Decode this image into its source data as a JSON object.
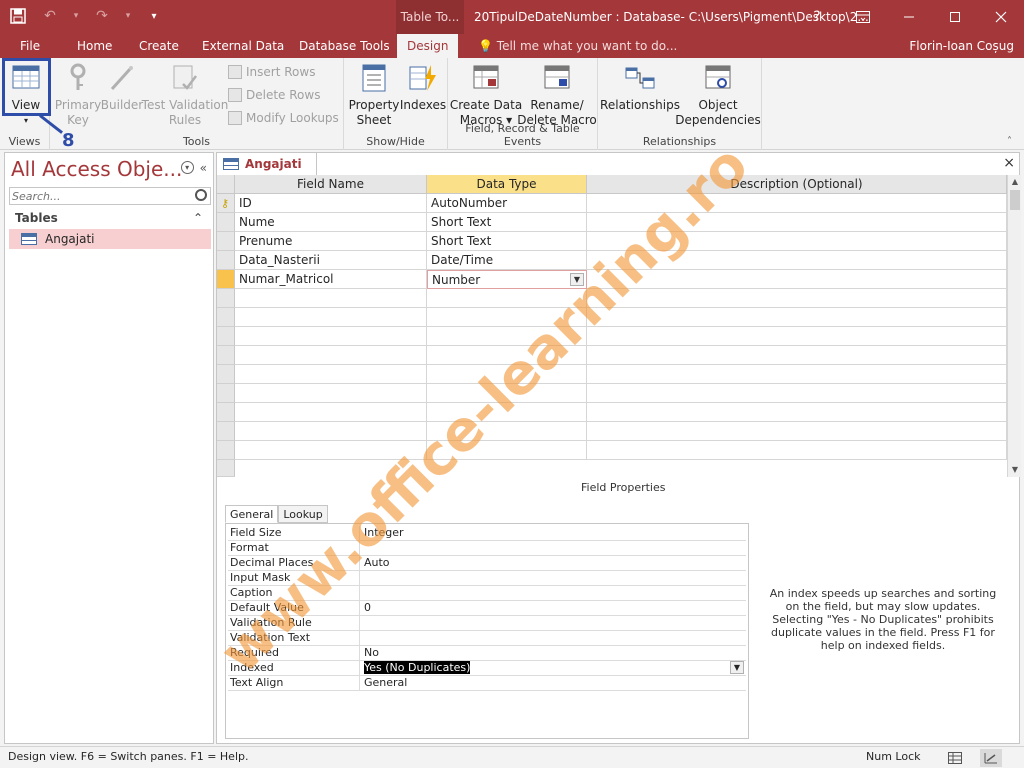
{
  "titlebar": {
    "contextual_tab": "Table To...",
    "window_title": "20TipulDeDateNumber : Database- C:\\Users\\Pigment\\Desktop\\2...",
    "help": "?",
    "qat_more": "▾"
  },
  "tabs": [
    {
      "label": "File"
    },
    {
      "label": "Home"
    },
    {
      "label": "Create"
    },
    {
      "label": "External Data"
    },
    {
      "label": "Database Tools"
    },
    {
      "label": "Design"
    }
  ],
  "tell_me": "Tell me what you want to do...",
  "user": "Florin-Ioan Coșug",
  "ribbon": {
    "views": {
      "group": "Views",
      "view": "View"
    },
    "tools": {
      "group": "Tools",
      "primary_key": "Primary\nKey",
      "builder": "Builder",
      "test_rules": "Test Validation\nRules",
      "insert_rows": "Insert Rows",
      "delete_rows": "Delete Rows",
      "modify_lookups": "Modify Lookups"
    },
    "showhide": {
      "group": "Show/Hide",
      "property_sheet": "Property\nSheet",
      "indexes": "Indexes"
    },
    "events": {
      "group": "Field, Record & Table Events",
      "create_macros": "Create Data\nMacros ▾",
      "rename_macro": "Rename/\nDelete Macro"
    },
    "relationships": {
      "group": "Relationships",
      "relationships": "Relationships",
      "object_dep": "Object\nDependencies"
    }
  },
  "annotation": {
    "step": "8"
  },
  "nav": {
    "title": "All Access Obje...",
    "search_placeholder": "Search...",
    "section": "Tables",
    "items": [
      {
        "label": "Angajati"
      }
    ]
  },
  "doc": {
    "tab": "Angajati",
    "close": "×",
    "headers": {
      "field_name": "Field Name",
      "data_type": "Data Type",
      "description": "Description (Optional)"
    },
    "rows": [
      {
        "field": "ID",
        "type": "AutoNumber",
        "desc": ""
      },
      {
        "field": "Nume",
        "type": "Short Text",
        "desc": ""
      },
      {
        "field": "Prenume",
        "type": "Short Text",
        "desc": ""
      },
      {
        "field": "Data_Nasterii",
        "type": "Date/Time",
        "desc": ""
      },
      {
        "field": "Numar_Matricol",
        "type": "Number",
        "desc": ""
      }
    ],
    "field_properties": "Field Properties",
    "prop_tabs": [
      "General",
      "Lookup"
    ],
    "properties": [
      {
        "name": "Field Size",
        "value": "Integer"
      },
      {
        "name": "Format",
        "value": ""
      },
      {
        "name": "Decimal Places",
        "value": "Auto"
      },
      {
        "name": "Input Mask",
        "value": ""
      },
      {
        "name": "Caption",
        "value": ""
      },
      {
        "name": "Default Value",
        "value": "0"
      },
      {
        "name": "Validation Rule",
        "value": ""
      },
      {
        "name": "Validation Text",
        "value": ""
      },
      {
        "name": "Required",
        "value": "No"
      },
      {
        "name": "Indexed",
        "value": "Yes (No Duplicates)"
      },
      {
        "name": "Text Align",
        "value": "General"
      }
    ],
    "help": "An index speeds up searches and sorting on the field, but may slow updates. Selecting \"Yes - No Duplicates\" prohibits duplicate values in the field. Press F1 for help on indexed fields."
  },
  "watermark": "www.office-learning.ro",
  "status": {
    "text": "Design view.  F6 = Switch panes.  F1 = Help.",
    "numlock": "Num Lock"
  },
  "colors": {
    "accent": "#a4373a",
    "highlight": "#2e4da8",
    "watermark": "#f29738"
  }
}
